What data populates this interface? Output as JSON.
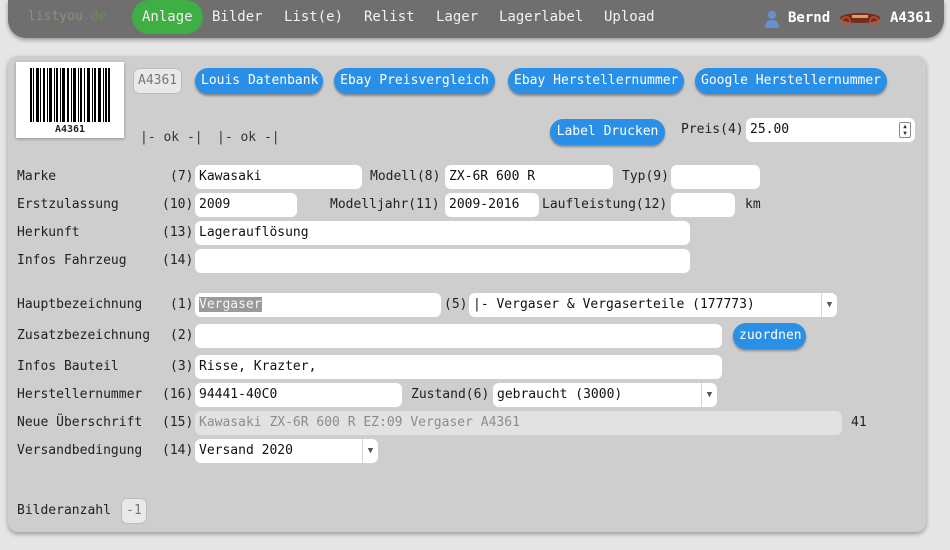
{
  "nav": {
    "logo": [
      "listyou",
      ".",
      "de"
    ],
    "items": [
      "Anlage",
      "Bilder",
      "List(e)",
      "Relist",
      "Lager",
      "Lagerlabel",
      "Upload"
    ],
    "user": "Bernd",
    "item_id": "A4361"
  },
  "header": {
    "barcode_text": "A4361",
    "id_tag": "A4361",
    "buttons": [
      "Louis Datenbank",
      "Ebay Preisvergleich",
      "Ebay Herstellernummer",
      "Google Herstellernummer"
    ],
    "ok1": "|- ok -|",
    "ok2": "|- ok -|",
    "print_label": "Label Drucken",
    "price_label": "Preis(4)",
    "price_value": "25.00"
  },
  "vehicle": {
    "marke_label": "Marke",
    "marke_num": "(7)",
    "marke_value": "Kawasaki",
    "modell_label": "Modell(8)",
    "modell_value": "ZX-6R 600 R",
    "typ_label": "Typ(9)",
    "typ_value": "",
    "erst_label": "Erstzulassung",
    "erst_num": "(10)",
    "erst_value": "2009",
    "mj_label": "Modelljahr(11)",
    "mj_value": "2009-2016",
    "ll_label": "Laufleistung(12)",
    "ll_value": "",
    "ll_unit": "km",
    "herkunft_label": "Herkunft",
    "herkunft_num": "(13)",
    "herkunft_value": "Lagerauflösung",
    "infos_fz_label": "Infos Fahrzeug",
    "infos_fz_num": "(14)",
    "infos_fz_value": ""
  },
  "part": {
    "haupt_label": "Hauptbezeichnung",
    "haupt_num": "(1)",
    "haupt_value": "Vergaser",
    "cat_num": "(5)",
    "cat_value": "|- Vergaser & Vergaserteile (177773)",
    "zusatz_label": "Zusatzbezeichnung",
    "zusatz_num": "(2)",
    "zusatz_value": "",
    "zuordnen": "zuordnen",
    "infos_bt_label": "Infos Bauteil",
    "infos_bt_num": "(3)",
    "infos_bt_value": "Risse, Krazter,",
    "hn_label": "Herstellernummer",
    "hn_num": "(16)",
    "hn_value": "94441-40C0",
    "zustand_label": "Zustand(6)",
    "zustand_value": "gebraucht (3000)",
    "ueber_label": "Neue Überschrift",
    "ueber_num": "(15)",
    "ueber_value": "Kawasaki ZX-6R 600 R EZ:09 Vergaser A4361",
    "ueber_count": "41",
    "versand_label": "Versandbedingung",
    "versand_num": "(14)",
    "versand_value": "Versand 2020",
    "bilder_label": "Bilderanzahl",
    "bilder_value": "-1"
  }
}
